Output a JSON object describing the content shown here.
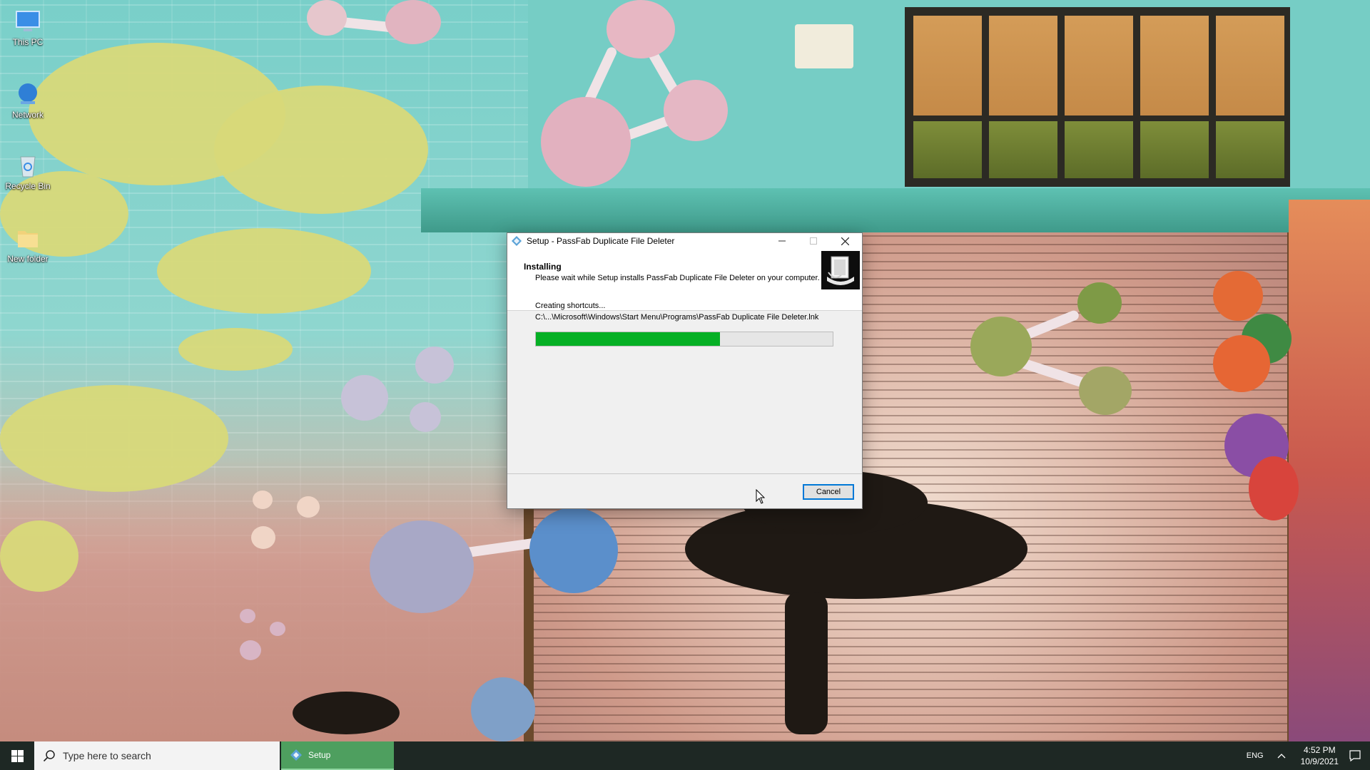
{
  "desktop": {
    "icons": [
      {
        "label": "This PC",
        "icon": "this-pc-icon"
      },
      {
        "label": "Network",
        "icon": "network-icon"
      },
      {
        "label": "Recycle Bin",
        "icon": "recycle-bin-icon"
      },
      {
        "label": "New folder",
        "icon": "folder-icon"
      }
    ]
  },
  "dialog": {
    "title": "Setup - PassFab Duplicate File Deleter",
    "header_title": "Installing",
    "header_subtitle": "Please wait while Setup installs PassFab Duplicate File Deleter on your computer.",
    "status": "Creating shortcuts...",
    "path": "C:\\...\\Microsoft\\Windows\\Start Menu\\Programs\\PassFab Duplicate File Deleter.lnk",
    "progress_percent": 62,
    "cancel_label": "Cancel",
    "progress_color": "#06b025"
  },
  "taskbar": {
    "search_placeholder": "Type here to search",
    "task_item_label": "Setup",
    "language": "ENG",
    "time": "4:52 PM",
    "date": "10/9/2021",
    "accent": "#4e9f5f"
  }
}
